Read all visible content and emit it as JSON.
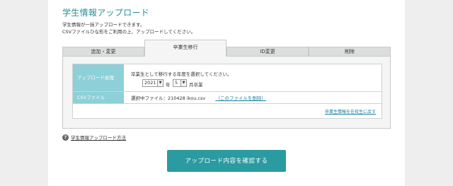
{
  "page": {
    "title": "学生情報アップロード",
    "desc_line1": "学生情報が一括アップロードできます。",
    "desc_line2": "CSVファイルひな形をご利用の上、アップロードしてください。"
  },
  "tabs": [
    {
      "label": "追加・変更"
    },
    {
      "label": "卒業生移行"
    },
    {
      "label": "ID変更"
    },
    {
      "label": "削除"
    }
  ],
  "form": {
    "row1_label": "アップロード処理",
    "instruction": "卒業生として移行する年度を選択してください。",
    "year_value": "2021",
    "year_unit": "年",
    "month_value": "5",
    "month_unit": "月卒業",
    "row2_label": "CSVファイル",
    "file_prefix": "選択中ファイル：210428 ikou.csv",
    "file_link": "（このファイルを削除）",
    "back_link": "卒業生情報を在校生に戻す"
  },
  "help": {
    "icon": "?",
    "label": "学生情報アップロード方法"
  },
  "confirm_button": "アップロード内容を確認する"
}
